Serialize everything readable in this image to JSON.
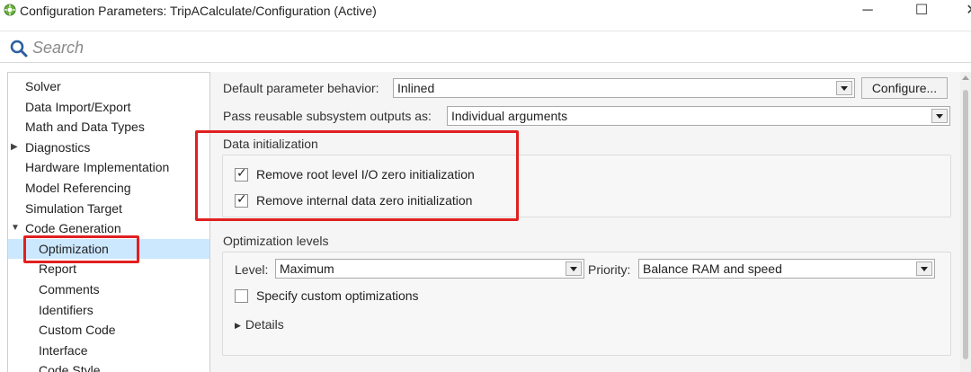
{
  "window": {
    "title": "Configuration Parameters: TripACalculate/Configuration (Active)",
    "minimize": "─",
    "maximize": "☐",
    "close": "✕"
  },
  "search": {
    "placeholder": "Search"
  },
  "tree": {
    "items": [
      {
        "label": "Solver",
        "level": 0
      },
      {
        "label": "Data Import/Export",
        "level": 0
      },
      {
        "label": "Math and Data Types",
        "level": 0
      },
      {
        "label": "Diagnostics",
        "level": 0,
        "expander": "collapsed"
      },
      {
        "label": "Hardware Implementation",
        "level": 0
      },
      {
        "label": "Model Referencing",
        "level": 0
      },
      {
        "label": "Simulation Target",
        "level": 0
      },
      {
        "label": "Code Generation",
        "level": 0,
        "expander": "expanded"
      },
      {
        "label": "Optimization",
        "level": 1,
        "selected": true
      },
      {
        "label": "Report",
        "level": 1
      },
      {
        "label": "Comments",
        "level": 1
      },
      {
        "label": "Identifiers",
        "level": 1
      },
      {
        "label": "Custom Code",
        "level": 1
      },
      {
        "label": "Interface",
        "level": 1
      },
      {
        "label": "Code Style",
        "level": 1
      }
    ],
    "expander_collapsed": "▶",
    "expander_expanded": "▼"
  },
  "main": {
    "default_param_label": "Default parameter behavior:",
    "default_param_value": "Inlined",
    "configure_button": "Configure...",
    "pass_reusable_label": "Pass reusable subsystem outputs as:",
    "pass_reusable_value": "Individual arguments",
    "data_init": {
      "title": "Data initialization",
      "options": [
        {
          "label": "Remove root level I/O zero initialization",
          "checked": true
        },
        {
          "label": "Remove internal data zero initialization",
          "checked": true
        }
      ]
    },
    "opt_levels": {
      "title": "Optimization levels",
      "level_label": "Level:",
      "level_value": "Maximum",
      "priority_label": "Priority:",
      "priority_value": "Balance RAM and speed",
      "custom_opt_label": "Specify custom optimizations",
      "custom_opt_checked": false,
      "details_label": "Details"
    }
  },
  "colors": {
    "highlight": "#e02020",
    "selection": "#cce8ff",
    "app_icon": "#4caf50"
  }
}
